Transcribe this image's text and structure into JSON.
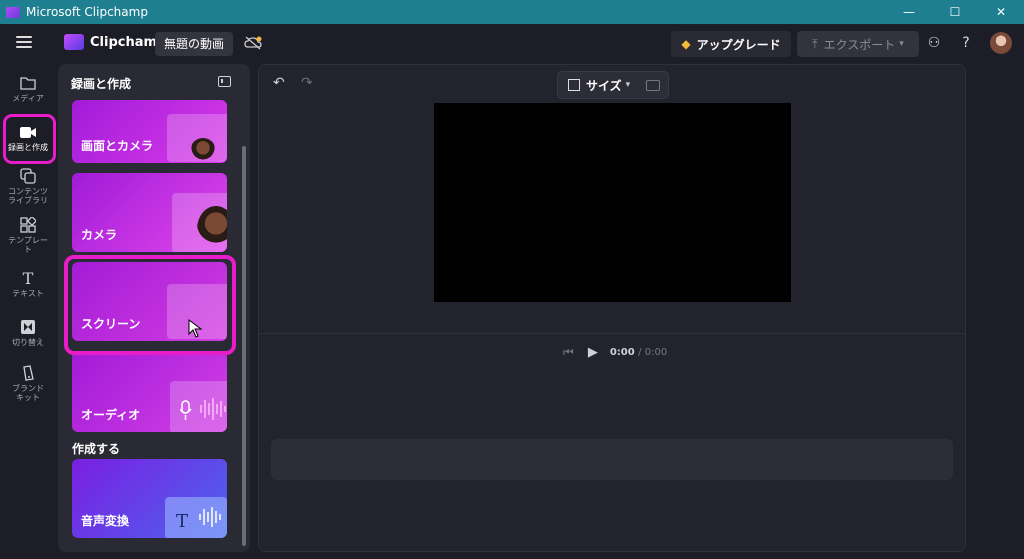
{
  "window": {
    "title": "Microsoft Clipchamp",
    "controls": [
      "—",
      "☐",
      "✕"
    ]
  },
  "header": {
    "brand": "Clipchamp",
    "project_title": "無題の動画",
    "upgrade_label": "アップグレード",
    "export_label": "エクスポート",
    "help": "?"
  },
  "rail": {
    "items": [
      {
        "label": "メディア",
        "icon": "folder-icon"
      },
      {
        "label": "録画と作成",
        "icon": "camera-icon"
      },
      {
        "label": "コンテンツ\nライブラリ",
        "icon": "library-icon"
      },
      {
        "label": "テンプレー\nト",
        "icon": "templates-icon"
      },
      {
        "label": "テキスト",
        "icon": "text-icon"
      },
      {
        "label": "切り替え",
        "icon": "transitions-icon"
      },
      {
        "label": "ブランド\nキット",
        "icon": "brand-kit-icon"
      }
    ]
  },
  "panel": {
    "title": "録画と作成",
    "cards": [
      {
        "label": "画面とカメラ"
      },
      {
        "label": "カメラ"
      },
      {
        "label": "スクリーン"
      },
      {
        "label": "オーディオ"
      }
    ],
    "section_create": "作成する",
    "create_cards": [
      {
        "label": "音声変換"
      }
    ]
  },
  "toolbar": {
    "size_label": "サイズ"
  },
  "player": {
    "current_time": "0:00",
    "total_time": "/ 0:00"
  },
  "colors": {
    "accent_magenta": "#e81cc8",
    "titlebar": "#1e7f91"
  }
}
